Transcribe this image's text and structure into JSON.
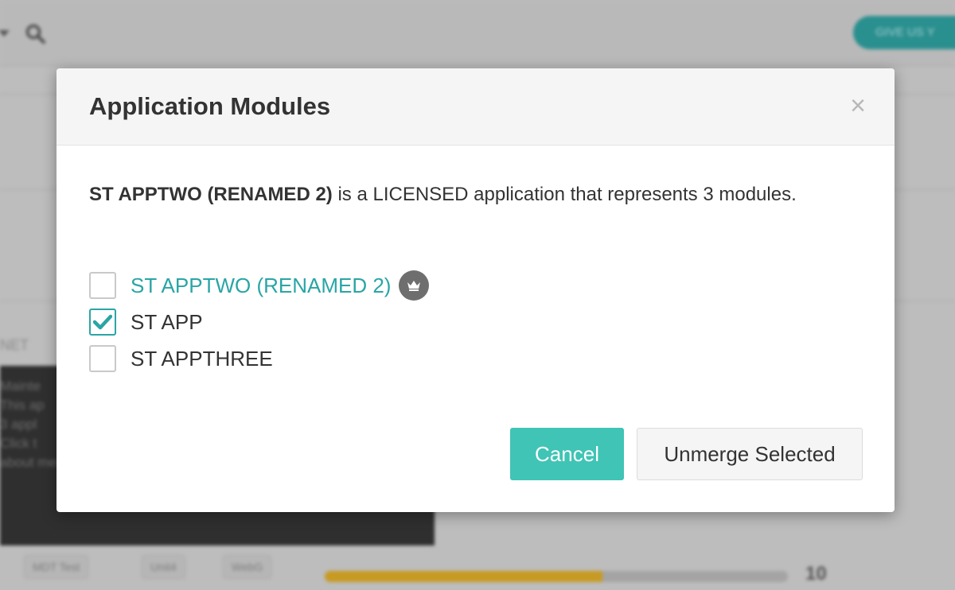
{
  "background": {
    "give_button": "GIVE US Y",
    "chips": [
      "MDT Test",
      "Unit4",
      "WebG"
    ],
    "net_label": "NET",
    "tooltip_lines": [
      "Mainte",
      "This ap",
      "3 appl",
      "Click t",
      "about merging"
    ],
    "progress_fraction": 0.6,
    "count": "10"
  },
  "modal": {
    "title": "Application Modules",
    "close_label": "×",
    "description": {
      "app_name": "ST APPTWO (RENAMED 2)",
      "text": " is a LICENSED application that represents 3 modules."
    },
    "options": [
      {
        "label": "ST APPTWO (RENAMED 2)",
        "checked": false,
        "primary": true,
        "icon": "crown-icon"
      },
      {
        "label": "ST APP",
        "checked": true,
        "primary": false
      },
      {
        "label": "ST APPTHREE",
        "checked": false,
        "primary": false
      }
    ],
    "cancel_label": "Cancel",
    "unmerge_label": "Unmerge Selected"
  },
  "colors": {
    "accent": "#2aa5a5",
    "cancel_bg": "#3fc4b5",
    "crown_bg": "#6e6e6e"
  }
}
